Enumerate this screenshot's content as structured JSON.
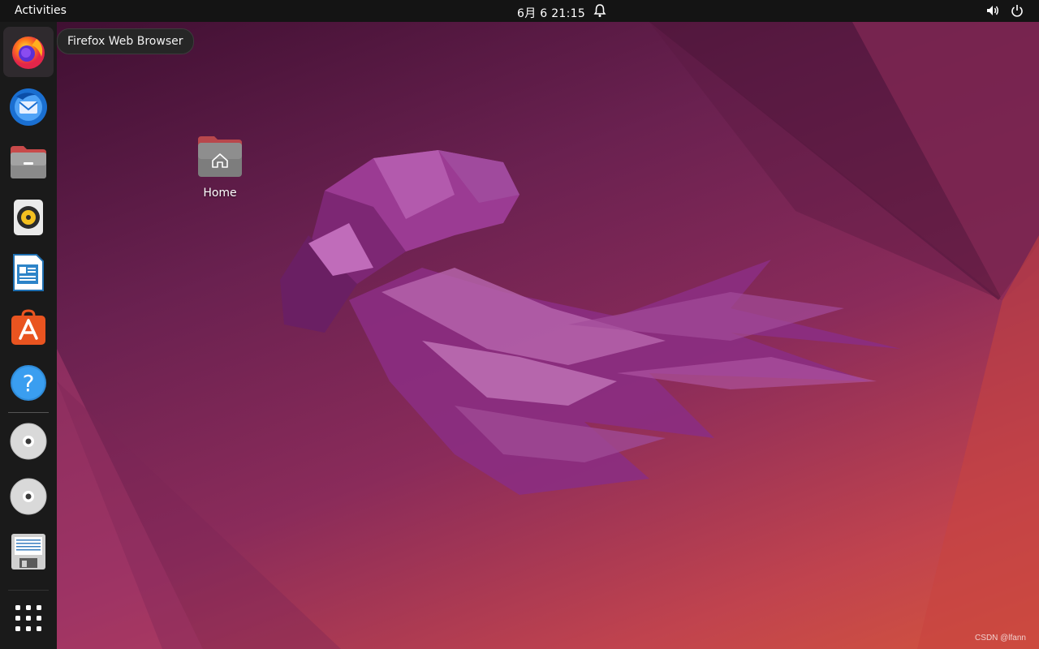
{
  "topbar": {
    "activities_label": "Activities",
    "clock": "6月 6  21:15",
    "icons": [
      "notification-bell-icon",
      "volume-icon",
      "power-icon"
    ]
  },
  "dock": {
    "items": [
      {
        "name": "Firefox Web Browser",
        "icon": "firefox-icon",
        "active": true
      },
      {
        "name": "Thunderbird Mail",
        "icon": "thunderbird-icon"
      },
      {
        "name": "Files",
        "icon": "files-icon"
      },
      {
        "name": "Rhythmbox",
        "icon": "rhythmbox-icon"
      },
      {
        "name": "LibreOffice Writer",
        "icon": "writer-icon"
      },
      {
        "name": "Ubuntu Software",
        "icon": "software-store-icon"
      },
      {
        "name": "Help",
        "icon": "help-icon"
      },
      {
        "name": "Optical disc 1",
        "icon": "disc-icon"
      },
      {
        "name": "Optical disc 2",
        "icon": "disc-icon"
      },
      {
        "name": "Floppy / save drive",
        "icon": "floppy-icon"
      },
      {
        "name": "Show Applications",
        "icon": "app-grid-icon"
      }
    ]
  },
  "tooltip": {
    "text": "Firefox Web Browser"
  },
  "desktop": {
    "home_label": "Home",
    "home_icon": "home-folder-icon"
  },
  "watermark": "CSDN @lfann",
  "colors": {
    "topbar": "#141414",
    "dock": "#1a1a1a",
    "accent": "#e95420"
  }
}
